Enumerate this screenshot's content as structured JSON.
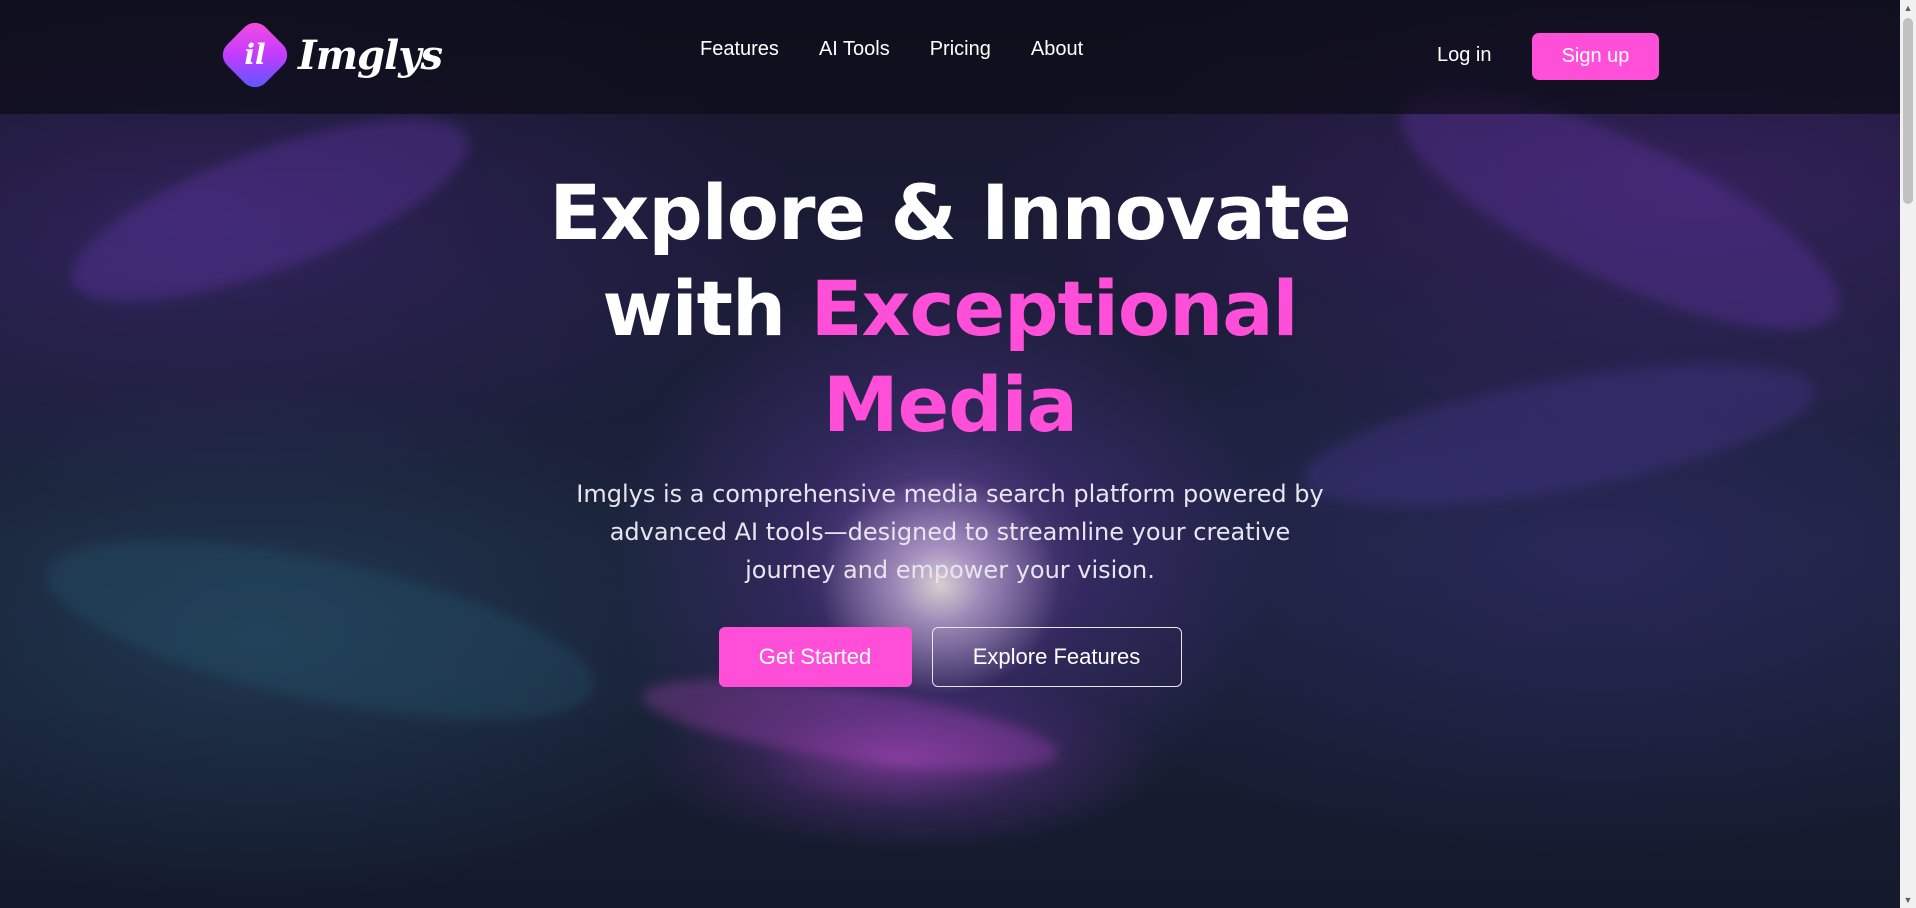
{
  "brand": {
    "mark": "il",
    "name": "Imglys",
    "colors": {
      "accent": "#ff4fd8",
      "background": "#151528"
    }
  },
  "nav": {
    "links": [
      "Features",
      "AI Tools",
      "Pricing",
      "About"
    ],
    "login_label": "Log in",
    "signup_label": "Sign up"
  },
  "hero": {
    "headline_line1": "Explore & Innovate",
    "headline_line2_white": "with",
    "headline_line2_accent": "Exceptional",
    "headline_line3_accent": "Media",
    "subtitle": "Imglys is a comprehensive media search platform powered by advanced AI tools—designed to streamline your creative journey and empower your vision.",
    "primary_cta": "Get Started",
    "secondary_cta": "Explore Features"
  },
  "scrollbar": {
    "up_icon": "▲",
    "down_icon": "▼"
  }
}
